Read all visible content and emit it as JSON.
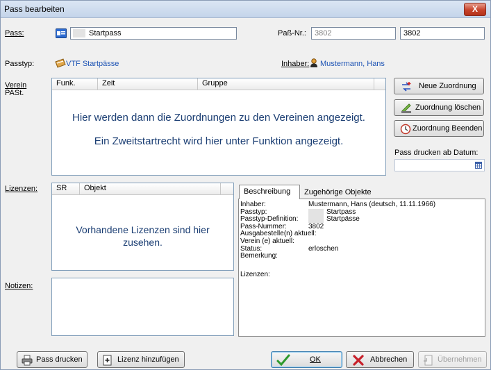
{
  "window": {
    "title": "Pass bearbeiten",
    "close_symbol": "X"
  },
  "pass": {
    "label": "Pass:",
    "value": "Startpass"
  },
  "passnr": {
    "label": "Paß-Nr.:",
    "value1": "3802",
    "value2": "3802"
  },
  "passtyp": {
    "label": "Passtyp:",
    "value": "VTF Startpässe"
  },
  "inhaber": {
    "label": "Inhaber:",
    "value": "Mustermann, Hans"
  },
  "verein": {
    "label_line1": "Verein",
    "label_line2": "PASt.",
    "columns": [
      "Funk.",
      "Zeit",
      "Gruppe"
    ],
    "message_line1": "Hier werden dann die Zuordnungen zu den Vereinen angezeigt.",
    "message_line2": "Ein Zweitstartrecht wird hier unter Funktion angezeigt."
  },
  "side_buttons": {
    "neue_zuordnung": "Neue Zuordnung",
    "zuordnung_loeschen": "Zuordnung löschen",
    "zuordnung_beenden": "Zuordnung Beenden"
  },
  "druck_datum": {
    "label": "Pass drucken ab Datum:",
    "value": ""
  },
  "lizenzen": {
    "label": "Lizenzen:",
    "columns": [
      "SR",
      "Objekt"
    ],
    "message": "Vorhandene Lizenzen sind hier zusehen."
  },
  "notizen": {
    "label": "Notizen:",
    "value": ""
  },
  "tabs": {
    "beschreibung": "Beschreibung",
    "objekte": "Zugehörige Objekte"
  },
  "beschreibung": {
    "inhaber_k": "Inhaber:",
    "inhaber_v": "Mustermann, Hans  (deutsch, 11.11.1966)",
    "passtyp_k": "Passtyp:",
    "passtyp_v": "Startpass",
    "passdef_k": "Passtyp-Definition:",
    "passdef_v": "Startpässe",
    "passnr_k": "Pass-Nummer:",
    "passnr_v": "3802",
    "ausgabe": "Ausgabestelle(n) aktuell:",
    "verein": "Verein (e) aktuell:",
    "status_k": "Status:",
    "status_v": "erloschen",
    "bemerkung": "Bemerkung:",
    "lizenzen": "Lizenzen:"
  },
  "bottom_buttons": {
    "pass_drucken": "Pass drucken",
    "lizenz_hinzufuegen": "Lizenz hinzufügen",
    "ok": "OK",
    "abbrechen": "Abbrechen",
    "uebernehmen": "Übernehmen"
  },
  "colors": {
    "accent_text": "#1b3e73",
    "link": "#1f55b5",
    "ok_green": "#2e9a2e",
    "cancel_red": "#c8202a"
  }
}
